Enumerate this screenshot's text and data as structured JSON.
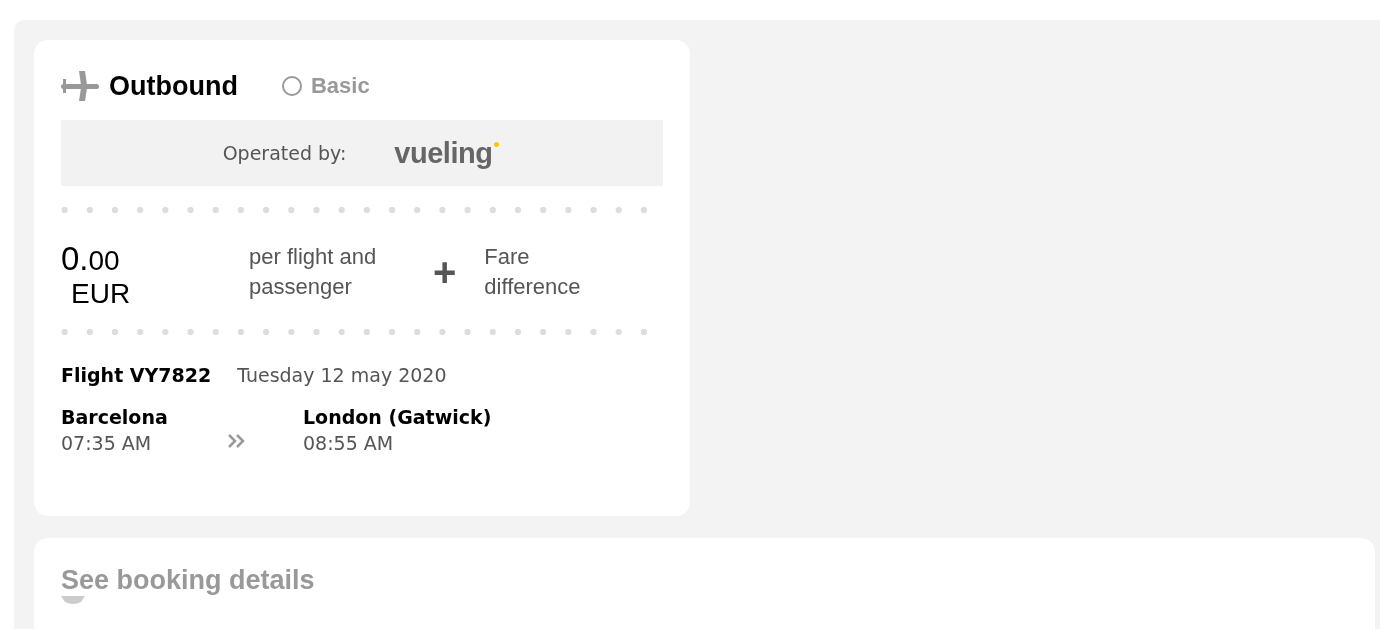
{
  "outbound": {
    "title": "Outbound",
    "fare_option": {
      "label": "Basic",
      "selected": false
    },
    "operator": {
      "label": "Operated by:",
      "airline": "vueling"
    },
    "price": {
      "integer": "0.",
      "decimals": "00",
      "currency": "EUR",
      "note": "per flight and passenger",
      "plus": "+",
      "extra": "Fare difference"
    },
    "flight": {
      "number": "Flight VY7822",
      "date": "Tuesday 12 may 2020"
    },
    "origin": {
      "city": "Barcelona",
      "time": "07:35 AM"
    },
    "destination": {
      "city": "London (Gatwick)",
      "time": "08:55 AM"
    }
  },
  "details": {
    "label": "See booking details"
  }
}
